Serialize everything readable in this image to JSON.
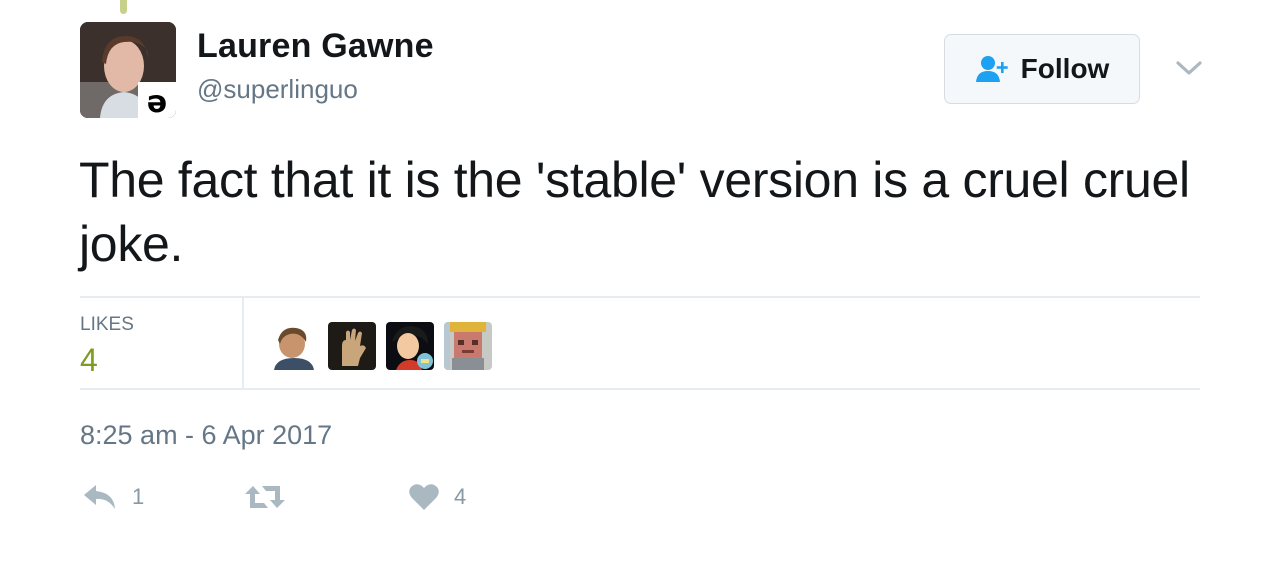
{
  "tweet": {
    "author": {
      "name": "Lauren Gawne",
      "handle": "@superlinguo",
      "avatar_icon": "profile-photo"
    },
    "follow_label": "Follow",
    "text": "The fact that it is the 'stable' version is a cruel cruel joke.",
    "likes": {
      "label": "LIKES",
      "count": "4",
      "liker_avatars": [
        "liker-avatar-1",
        "liker-avatar-2",
        "liker-avatar-3",
        "liker-avatar-4"
      ]
    },
    "timestamp": "8:25 am - 6 Apr 2017",
    "actions": {
      "reply_count": "1",
      "retweet_count": "",
      "like_count": "4"
    }
  },
  "colors": {
    "text": "#14171a",
    "muted": "#657786",
    "accent_blue": "#1da1f2",
    "likes_green": "#7c9c24",
    "action_gray": "#aab8c2",
    "border": "#e6ecf0"
  }
}
